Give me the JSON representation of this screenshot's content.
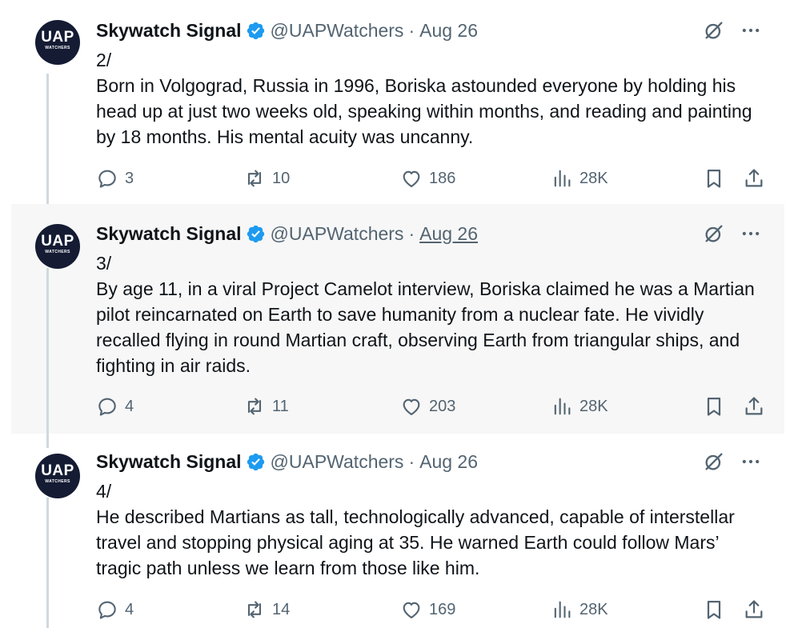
{
  "tweets": [
    {
      "avatar": {
        "big": "UAP",
        "small": "WATCHERS"
      },
      "name": "Skywatch Signal",
      "handle": "@UAPWatchers",
      "separator": "·",
      "date": "Aug 26",
      "thread_no": "2/",
      "text": "Born in Volgograd, Russia in 1996, Boriska astounded everyone by holding his head up at just two weeks old, speaking within months, and reading and painting by 18 months. His mental acuity was uncanny.",
      "replies": "3",
      "retweets": "10",
      "likes": "186",
      "views": "28K"
    },
    {
      "avatar": {
        "big": "UAP",
        "small": "WATCHERS"
      },
      "name": "Skywatch Signal",
      "handle": "@UAPWatchers",
      "separator": "·",
      "date": "Aug 26",
      "thread_no": "3/",
      "text": "By age 11, in a viral Project Camelot interview, Boriska claimed he was a Martian pilot reincarnated on Earth to save humanity from a nuclear fate. He vividly recalled flying in round Martian craft, observing Earth from triangular ships, and fighting in air raids.",
      "replies": "4",
      "retweets": "11",
      "likes": "203",
      "views": "28K"
    },
    {
      "avatar": {
        "big": "UAP",
        "small": "WATCHERS"
      },
      "name": "Skywatch Signal",
      "handle": "@UAPWatchers",
      "separator": "·",
      "date": "Aug 26",
      "thread_no": "4/",
      "text": "He described Martians as tall, technologically advanced, capable of interstellar travel and stopping physical aging at 35. He warned Earth could follow Mars’ tragic path unless we learn from those like him.",
      "replies": "4",
      "retweets": "14",
      "likes": "169",
      "views": "28K"
    }
  ],
  "colors": {
    "verified": "#1d9bf0",
    "secondary_text": "#536471",
    "hover_bg": "#f7f7f7",
    "avatar_bg": "#141b33"
  },
  "icons": [
    "reply-icon",
    "retweet-icon",
    "like-icon",
    "views-icon",
    "bookmark-icon",
    "share-icon",
    "grok-icon",
    "more-icon",
    "verified-badge-icon"
  ]
}
